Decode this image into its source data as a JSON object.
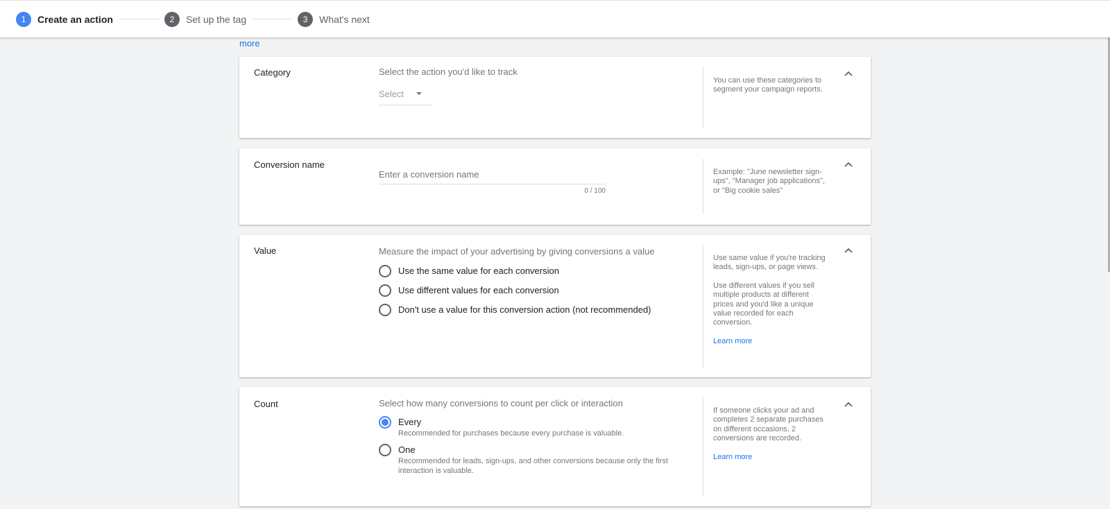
{
  "stepper": {
    "steps": [
      {
        "number": "1",
        "label": "Create an action",
        "active": true
      },
      {
        "number": "2",
        "label": "Set up the tag",
        "active": false
      },
      {
        "number": "3",
        "label": "What's next",
        "active": false
      }
    ]
  },
  "top_link": "more",
  "sections": {
    "category": {
      "title": "Category",
      "description": "Select the action you'd like to track",
      "select_value": "Select",
      "help": "You can use these categories to segment your campaign reports."
    },
    "conversion_name": {
      "title": "Conversion name",
      "placeholder": "Enter a conversion name",
      "value": "",
      "counter": "0 / 100",
      "help": "Example: \"June newsletter sign-ups\", \"Manager job applications\", or \"Big cookie sales\""
    },
    "value": {
      "title": "Value",
      "description": "Measure the impact of your advertising by giving conversions a value",
      "options": [
        {
          "label": "Use the same value for each conversion",
          "checked": false
        },
        {
          "label": "Use different values for each conversion",
          "checked": false
        },
        {
          "label": "Don't use a value for this conversion action (not recommended)",
          "checked": false
        }
      ],
      "help": [
        "Use same value if you're tracking leads, sign-ups, or page views.",
        "Use different values if you sell multiple products at different prices and you'd like a unique value recorded for each conversion."
      ],
      "learn_more": "Learn more"
    },
    "count": {
      "title": "Count",
      "description": "Select how many conversions to count per click or interaction",
      "options": [
        {
          "label": "Every",
          "sublabel": "Recommended for purchases because every purchase is valuable.",
          "checked": true
        },
        {
          "label": "One",
          "sublabel": "Recommended for leads, sign-ups, and other conversions because only the first interaction is valuable.",
          "checked": false
        }
      ],
      "help": "If someone clicks your ad and completes 2 separate purchases on different occasions, 2 conversions are recorded.",
      "learn_more": "Learn more"
    }
  },
  "colors": {
    "accent": "#4285f4",
    "link": "#1a73e8",
    "background": "#f1f3f4"
  }
}
